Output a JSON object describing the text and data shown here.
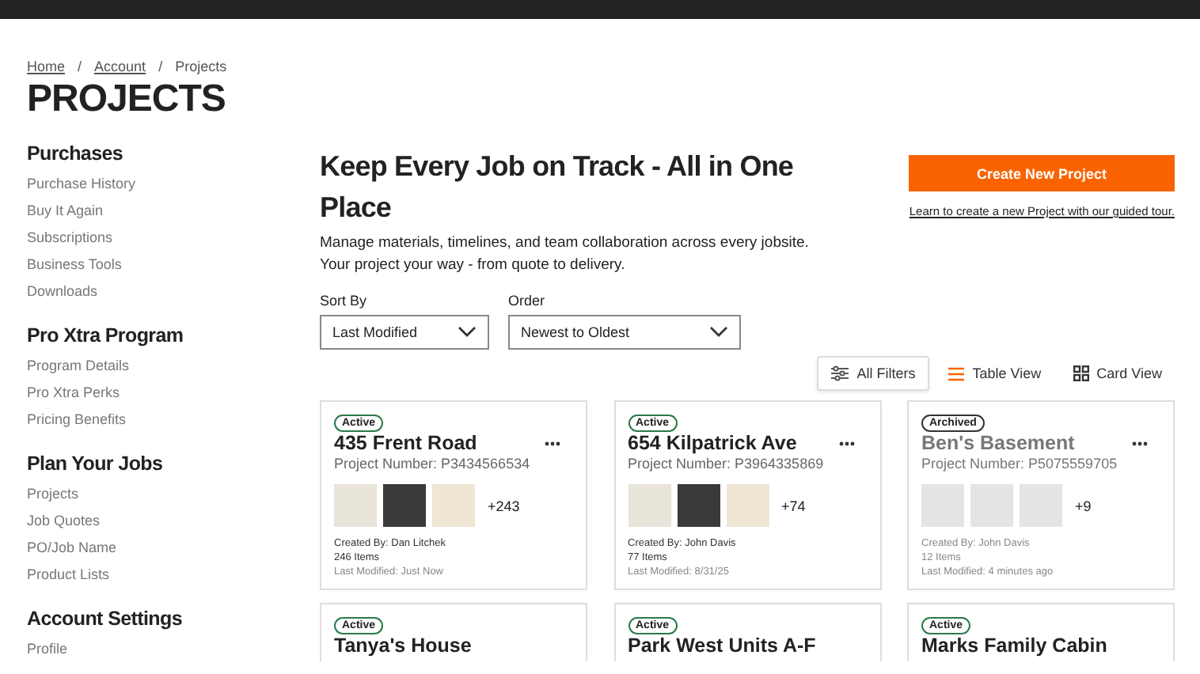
{
  "breadcrumb": [
    {
      "label": "Home",
      "link": true
    },
    {
      "label": "Account",
      "link": true
    },
    {
      "label": "Projects",
      "link": false
    }
  ],
  "breadcrumb_separator": "/",
  "page_title": "PROJECTS",
  "sidebar": {
    "groups": [
      {
        "heading": "Purchases",
        "items": [
          "Purchase History",
          "Buy It Again",
          "Subscriptions",
          "Business Tools",
          "Downloads"
        ]
      },
      {
        "heading": "Pro Xtra Program",
        "items": [
          "Program Details",
          "Pro Xtra Perks",
          "Pricing Benefits"
        ]
      },
      {
        "heading": "Plan Your Jobs",
        "items": [
          "Projects",
          "Job Quotes",
          "PO/Job Name",
          "Product Lists"
        ]
      },
      {
        "heading": "Account Settings",
        "items": [
          "Profile"
        ]
      }
    ]
  },
  "hero": {
    "title": "Keep Every Job on Track - All in One Place",
    "description": [
      "Manage materials, timelines, and team collaboration across every jobsite.",
      "Your project your way - from quote to delivery."
    ]
  },
  "create_button": "Create New Project",
  "tour_link": "Learn to create a new Project with our guided tour.",
  "sort_by": {
    "label": "Sort By",
    "value": "Last Modified"
  },
  "order": {
    "label": "Order",
    "value": "Newest to Oldest"
  },
  "filters_button": "All Filters",
  "view_options": [
    {
      "kind": "table",
      "label": "Table View"
    },
    {
      "kind": "card",
      "label": "Card View"
    }
  ],
  "projects": [
    {
      "status": "Active",
      "archived": false,
      "name": "435 Frent Road",
      "number": "Project Number: P3434566534",
      "more": "+243",
      "created_by": "Created By: Dan Litchek",
      "items": "246 Items",
      "modified": "Last Modified: Just Now"
    },
    {
      "status": "Active",
      "archived": false,
      "name": "654 Kilpatrick Ave",
      "number": "Project Number: P3964335869",
      "more": "+74",
      "created_by": "Created By: John Davis",
      "items": "77 Items",
      "modified": "Last Modified: 8/31/25"
    },
    {
      "status": "Archived",
      "archived": true,
      "name": "Ben's Basement",
      "number": "Project Number: P5075559705",
      "more": "+9",
      "created_by": "Created By: John Davis",
      "items": "12 Items",
      "modified": "Last Modified: 4 minutes ago"
    },
    {
      "status": "Active",
      "archived": false,
      "name": "Tanya's House"
    },
    {
      "status": "Active",
      "archived": false,
      "name": "Park West Units A-F"
    },
    {
      "status": "Active",
      "archived": false,
      "name": "Marks Family Cabin"
    }
  ]
}
